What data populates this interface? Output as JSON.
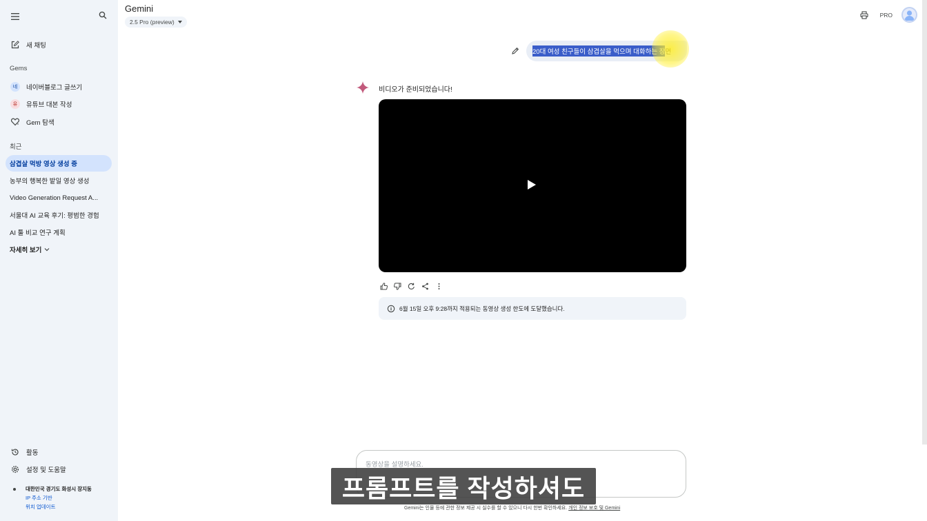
{
  "sidebar": {
    "new_chat": "새 채팅",
    "gems_heading": "Gems",
    "gems": [
      {
        "badge": "네",
        "label": "네이버블로그 글쓰기",
        "badge_bg": "#d3e3fd",
        "badge_color": "#0842a0"
      },
      {
        "badge": "유",
        "label": "유튜브 대본 작성",
        "badge_bg": "#f9dde0",
        "badge_color": "#b3261e"
      }
    ],
    "explore_gems": "Gem 탐색",
    "recent_heading": "최근",
    "recent": [
      {
        "label": "삼겹살 먹방 영상 생성 중"
      },
      {
        "label": "농부의 행복한 밭일 영상 생성"
      },
      {
        "label": "Video Generation Request A..."
      },
      {
        "label": "서울대 AI 교육 후기: 평범한 경험"
      },
      {
        "label": "AI 툴 비교 연구 계획"
      }
    ],
    "show_more": "자세히 보기",
    "activity": "활동",
    "settings": "설정 및 도움말",
    "location": {
      "place": "대한민국 경기도 화성시 장지동",
      "basis": "IP 주소 기반",
      "update": "위치 업데이트"
    }
  },
  "header": {
    "app_title": "Gemini",
    "model": "2.5 Pro (preview)",
    "pro_badge": "PRO"
  },
  "conversation": {
    "user_prompt_selected": "20대 여성 친구들이 삼겹살을 먹으며 대화하는 장",
    "user_prompt_rest": "면",
    "response_text": "비디오가 준비되었습니다!",
    "notice": "6월 15일 오후 9:28까지 적용되는 동영상 생성 한도에 도달했습니다."
  },
  "composer": {
    "placeholder": "동영상을 설명하세요."
  },
  "footer": {
    "text": "Gemini는 인물 등에 관한 정보 제공 시 실수를 할 수 있으니 다시 한번 확인하세요.",
    "link": "개인 정보 보호 및 Gemini"
  },
  "caption": "프롬프트를 작성하셔도",
  "colors": {
    "sidebar_bg": "#f0f4f9",
    "active_item_bg": "#d3e3fd",
    "selection": "#3a5dc9",
    "accent_link": "#0b57d0",
    "spark": "#c25a7c"
  }
}
